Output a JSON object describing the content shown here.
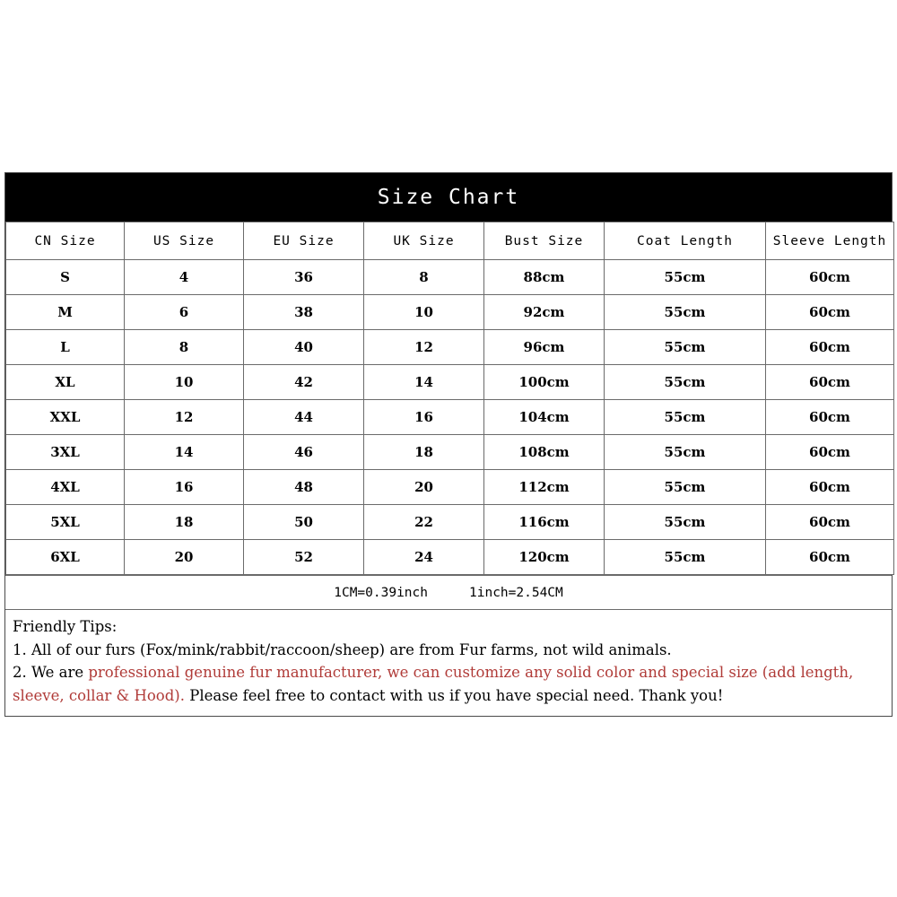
{
  "chart": {
    "title": "Size Chart",
    "columns": [
      "CN Size",
      "US Size",
      "EU Size",
      "UK Size",
      "Bust Size",
      "Coat Length",
      "Sleeve Length"
    ],
    "rows": [
      [
        "S",
        "4",
        "36",
        "8",
        "88cm",
        "55cm",
        "60cm"
      ],
      [
        "M",
        "6",
        "38",
        "10",
        "92cm",
        "55cm",
        "60cm"
      ],
      [
        "L",
        "8",
        "40",
        "12",
        "96cm",
        "55cm",
        "60cm"
      ],
      [
        "XL",
        "10",
        "42",
        "14",
        "100cm",
        "55cm",
        "60cm"
      ],
      [
        "XXL",
        "12",
        "44",
        "16",
        "104cm",
        "55cm",
        "60cm"
      ],
      [
        "3XL",
        "14",
        "46",
        "18",
        "108cm",
        "55cm",
        "60cm"
      ],
      [
        "4XL",
        "16",
        "48",
        "20",
        "112cm",
        "55cm",
        "60cm"
      ],
      [
        "5XL",
        "18",
        "50",
        "22",
        "116cm",
        "55cm",
        "60cm"
      ],
      [
        "6XL",
        "20",
        "52",
        "24",
        "120cm",
        "55cm",
        "60cm"
      ]
    ],
    "conversion": {
      "cm_to_inch": "1CM=0.39inch",
      "inch_to_cm": "1inch=2.54CM"
    },
    "colors": {
      "title_bar_background": "#000000",
      "title_text": "#ffffff",
      "table_border": "#6b6b6b",
      "text": "#000000",
      "highlight_red": "#b03b38"
    }
  },
  "tips": {
    "heading": "Friendly Tips:",
    "line1": "1. All of our furs (Fox/mink/rabbit/raccoon/sheep) are from Fur farms, not wild animals.",
    "line2_prefix": "2. We are ",
    "line2_red": "professional genuine fur manufacturer, we can customize any solid color and special size (add length, sleeve, collar & Hood).",
    "line2_suffix": " Please feel free to contact with us if you have special need. Thank you!"
  }
}
